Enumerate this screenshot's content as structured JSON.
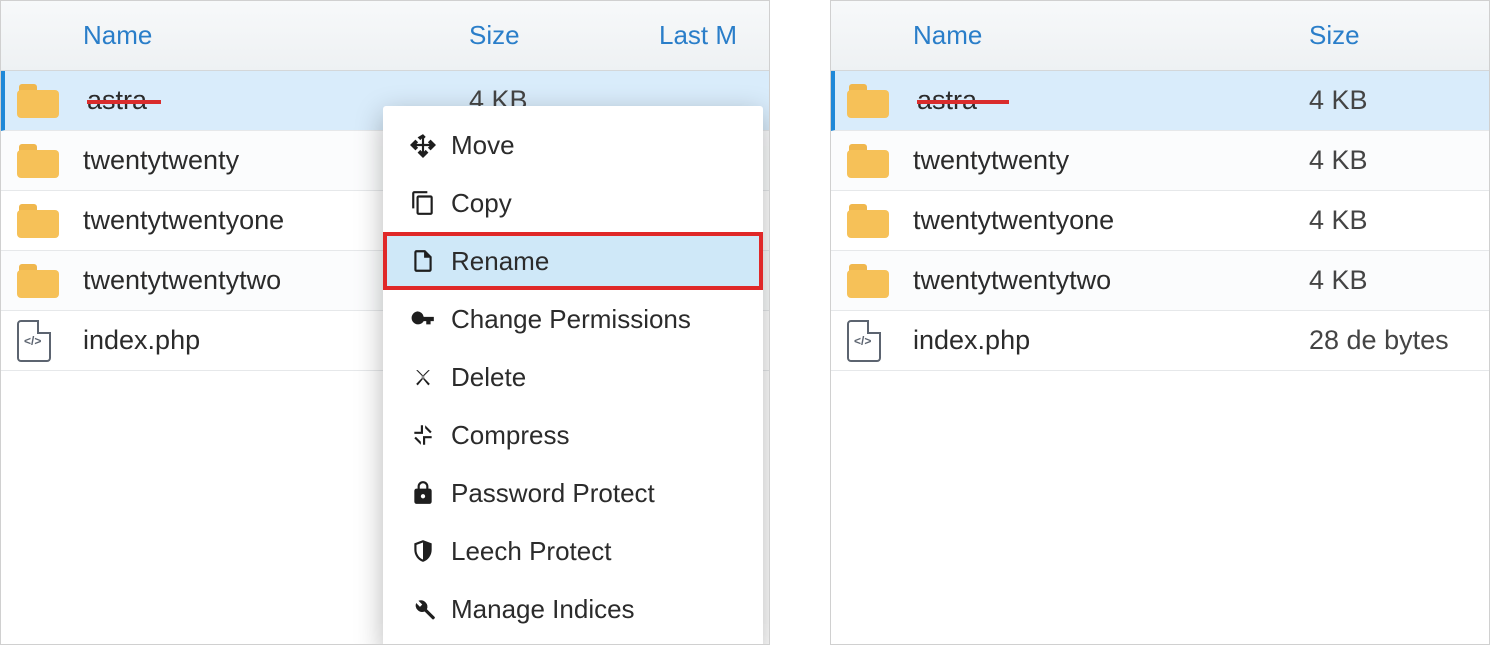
{
  "left_panel": {
    "headers": {
      "name": "Name",
      "size": "Size",
      "last": "Last M"
    },
    "rows": [
      {
        "name": "astra",
        "size": "4 KB",
        "last": "",
        "selected": true,
        "type": "folder",
        "underline_width": 74
      },
      {
        "name": "twentytwenty",
        "size": "",
        "last": "",
        "type": "folder"
      },
      {
        "name": "twentytwentyone",
        "size": "",
        "last": "",
        "type": "folder"
      },
      {
        "name": "twentytwentytwo",
        "size": "",
        "last": "",
        "type": "folder"
      },
      {
        "name": "index.php",
        "size": "",
        "last": "",
        "type": "file"
      }
    ]
  },
  "right_panel": {
    "headers": {
      "name": "Name",
      "size": "Size"
    },
    "rows": [
      {
        "name": "astra--",
        "size": "4 KB",
        "selected": true,
        "type": "folder",
        "underline_width": 92
      },
      {
        "name": "twentytwenty",
        "size": "4 KB",
        "type": "folder"
      },
      {
        "name": "twentytwentyone",
        "size": "4 KB",
        "type": "folder"
      },
      {
        "name": "twentytwentytwo",
        "size": "4 KB",
        "type": "folder"
      },
      {
        "name": "index.php",
        "size": "28 de bytes",
        "type": "file"
      }
    ]
  },
  "context_menu": {
    "items": [
      {
        "label": "Move",
        "icon": "move",
        "highlight": false
      },
      {
        "label": "Copy",
        "icon": "copy",
        "highlight": false
      },
      {
        "label": "Rename",
        "icon": "rename",
        "highlight": true
      },
      {
        "label": "Change Permissions",
        "icon": "key",
        "highlight": false
      },
      {
        "label": "Delete",
        "icon": "delete",
        "highlight": false
      },
      {
        "label": "Compress",
        "icon": "compress",
        "highlight": false
      },
      {
        "label": "Password Protect",
        "icon": "lock",
        "highlight": false
      },
      {
        "label": "Leech Protect",
        "icon": "shield",
        "highlight": false
      },
      {
        "label": "Manage Indices",
        "icon": "wrench",
        "highlight": false
      }
    ]
  }
}
